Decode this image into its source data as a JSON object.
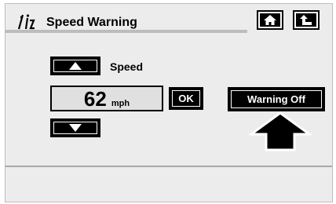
{
  "header": {
    "title": "Speed Warning",
    "icon": "settings-sliders-icon",
    "home_icon": "home-icon",
    "back_icon": "back-arrow-icon"
  },
  "speed": {
    "label": "Speed",
    "value": "62",
    "unit": "mph",
    "up_icon": "triangle-up-icon",
    "down_icon": "triangle-down-icon"
  },
  "buttons": {
    "ok_label": "OK",
    "warning_label": "Warning Off"
  },
  "pointer": {
    "icon": "pointer-arrow-icon"
  },
  "colors": {
    "background": "#ececec",
    "button": "#000000",
    "text_on_button": "#ffffff"
  }
}
